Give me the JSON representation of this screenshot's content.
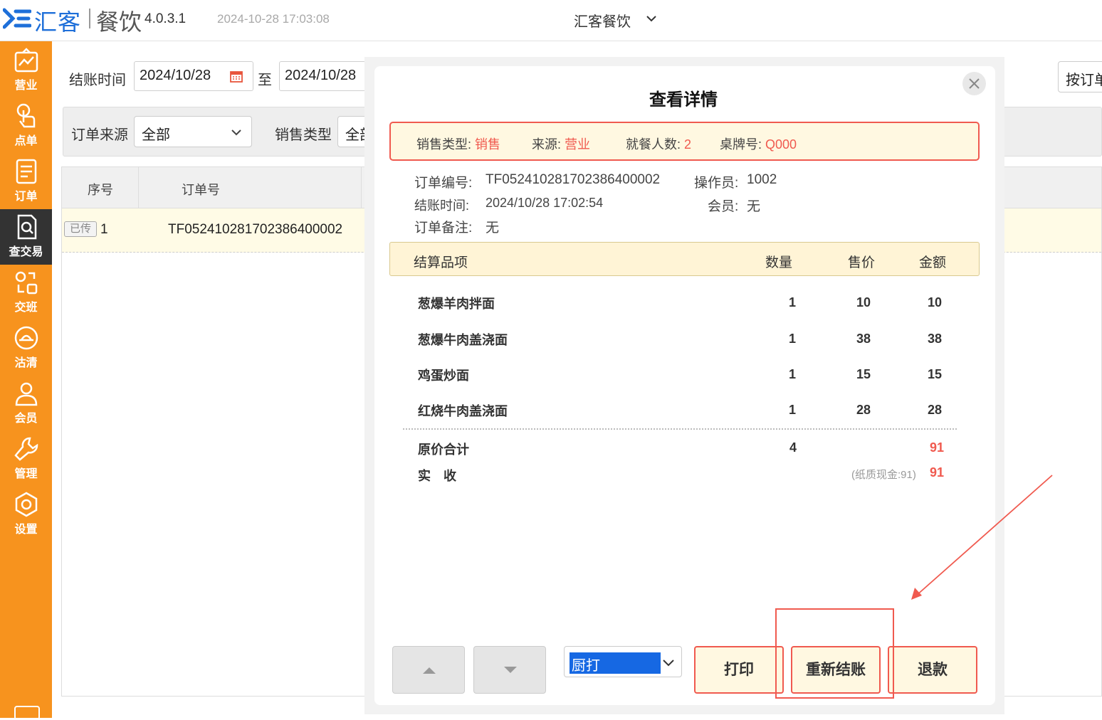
{
  "app": {
    "brand": "汇客",
    "product": "餐饮",
    "version": "4.0.3.1",
    "datetime": "2024-10-28 17:03:08",
    "store": "汇客餐饮",
    "accent": "#f7931e",
    "brand_color": "#1e6fd9",
    "alert_color": "#f05a4f"
  },
  "sidebar": {
    "items": [
      {
        "label": "营业",
        "icon": "business-chart-icon"
      },
      {
        "label": "点单",
        "icon": "hand-tap-icon"
      },
      {
        "label": "订单",
        "icon": "order-list-icon"
      },
      {
        "label": "查交易",
        "icon": "search-document-icon",
        "active": true
      },
      {
        "label": "交班",
        "icon": "shift-swap-icon"
      },
      {
        "label": "沽清",
        "icon": "sold-out-icon"
      },
      {
        "label": "会员",
        "icon": "member-icon"
      },
      {
        "label": "管理",
        "icon": "wrench-icon"
      },
      {
        "label": "设置",
        "icon": "gear-icon"
      }
    ]
  },
  "filters": {
    "checkout_time_label": "结账时间",
    "date_from": "2024/10/28",
    "to_label": "至",
    "date_to": "2024/10/28",
    "order_source_label": "订单来源",
    "order_source_value": "全部",
    "sale_type_label": "销售类型",
    "sale_type_value": "全部",
    "right_button": "按订单"
  },
  "table": {
    "headers": [
      "序号",
      "订单号"
    ],
    "rows": [
      {
        "status": "已传",
        "index": "1",
        "order_no": "TF052410281702386400002"
      }
    ]
  },
  "modal": {
    "title": "查看详情",
    "info": {
      "sale_type_label": "销售类型:",
      "sale_type": "销售",
      "source_label": "来源:",
      "source": "营业",
      "diners_label": "就餐人数:",
      "diners": "2",
      "table_label": "桌牌号:",
      "table": "Q000"
    },
    "meta": {
      "order_no_label": "订单编号:",
      "order_no": "TF052410281702386400002",
      "operator_label": "操作员:",
      "operator": "1002",
      "checkout_label": "结账时间:",
      "checkout": "2024/10/28 17:02:54",
      "member_label": "会员:",
      "member": "无",
      "note_label": "订单备注:",
      "note": "无"
    },
    "items_header": {
      "name": "结算品项",
      "qty": "数量",
      "price": "售价",
      "amount": "金额"
    },
    "items": [
      {
        "name": "葱爆羊肉拌面",
        "qty": "1",
        "price": "10",
        "amount": "10"
      },
      {
        "name": "葱爆牛肉盖浇面",
        "qty": "1",
        "price": "38",
        "amount": "38"
      },
      {
        "name": "鸡蛋炒面",
        "qty": "1",
        "price": "15",
        "amount": "15"
      },
      {
        "name": "红烧牛肉盖浇面",
        "qty": "1",
        "price": "28",
        "amount": "28"
      }
    ],
    "totals": {
      "original_label": "原价合计",
      "original_qty": "4",
      "original_amount": "91",
      "received_label": "实　收",
      "payment_detail": "(纸质现金:91)",
      "received_amount": "91"
    },
    "controls": {
      "printer_option": "厨打",
      "print_label": "打印",
      "recheckout_label": "重新结账",
      "refund_label": "退款"
    }
  }
}
